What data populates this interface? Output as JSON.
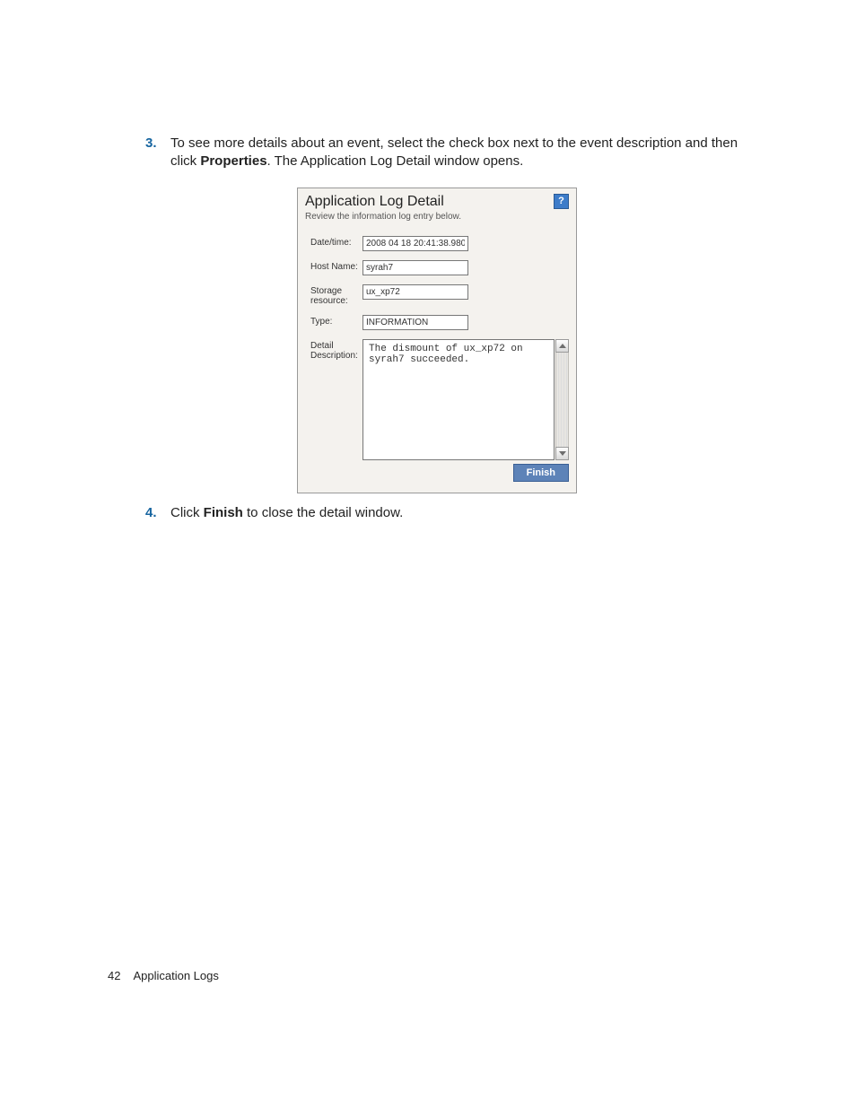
{
  "steps": {
    "s3": {
      "num": "3.",
      "text_before": "To see more details about an event, select the check box next to the event description and then click ",
      "properties": "Properties",
      "text_after": ". The Application Log Detail window opens."
    },
    "s4": {
      "num": "4.",
      "text_before": "Click ",
      "finish": "Finish",
      "text_after": " to close the detail window."
    }
  },
  "dialog": {
    "title": "Application Log Detail",
    "subtitle": "Review the information log entry below.",
    "help_glyph": "?",
    "labels": {
      "datetime": "Date/time:",
      "hostname": "Host Name:",
      "storage": "Storage resource:",
      "type": "Type:",
      "detail": "Detail Description:"
    },
    "values": {
      "datetime": "2008 04 18 20:41:38.980",
      "hostname": "syrah7",
      "storage": "ux_xp72",
      "type": "INFORMATION",
      "detail": "The dismount of ux_xp72 on syrah7 succeeded."
    },
    "finish_label": "Finish"
  },
  "footer": {
    "page_number": "42",
    "section": "Application Logs"
  }
}
